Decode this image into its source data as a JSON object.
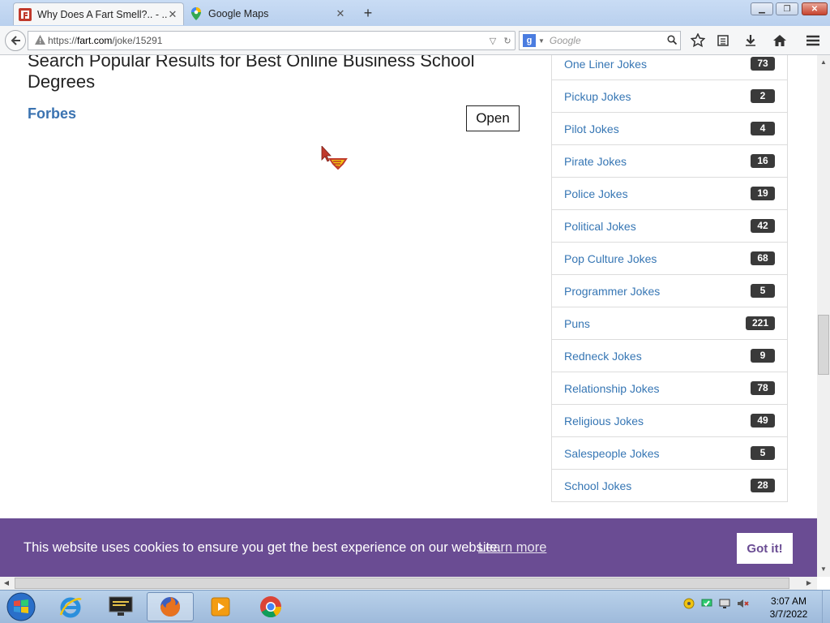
{
  "browser": {
    "tabs": [
      {
        "title": "Why Does A Fart Smell?.. - ...",
        "active": true,
        "favicon": "F"
      },
      {
        "title": "Google Maps",
        "active": false,
        "favicon": "maps-pin"
      }
    ],
    "new_tab": "+",
    "url_prefix": "https://",
    "url_host": "fart.com",
    "url_path": "/joke/15291",
    "search_placeholder": "Google",
    "search_engine_glyph": "g"
  },
  "ad": {
    "title": "Search Popular Results for Best Online Business School Degrees",
    "source": "Forbes",
    "open_label": "Open"
  },
  "sidebar": {
    "categories": [
      {
        "name": "One Liner Jokes",
        "count": "73"
      },
      {
        "name": "Pickup Jokes",
        "count": "2"
      },
      {
        "name": "Pilot Jokes",
        "count": "4"
      },
      {
        "name": "Pirate Jokes",
        "count": "16"
      },
      {
        "name": "Police Jokes",
        "count": "19"
      },
      {
        "name": "Political Jokes",
        "count": "42"
      },
      {
        "name": "Pop Culture Jokes",
        "count": "68"
      },
      {
        "name": "Programmer Jokes",
        "count": "5"
      },
      {
        "name": "Puns",
        "count": "221"
      },
      {
        "name": "Redneck Jokes",
        "count": "9"
      },
      {
        "name": "Relationship Jokes",
        "count": "78"
      },
      {
        "name": "Religious Jokes",
        "count": "49"
      },
      {
        "name": "Salespeople Jokes",
        "count": "5"
      },
      {
        "name": "School Jokes",
        "count": "28"
      }
    ]
  },
  "cookie": {
    "message": "This website uses cookies to ensure you get the best experience on our website.",
    "learn_more": "Learn more",
    "accept": "Got it!",
    "color": "#6a4c93"
  },
  "taskbar": {
    "time": "3:07 AM",
    "date": "3/7/2022",
    "apps": [
      "internet-explorer",
      "media-center",
      "firefox",
      "video-player",
      "chrome"
    ]
  },
  "colors": {
    "link": "#3676b4",
    "badge": "#3a3a3a"
  }
}
